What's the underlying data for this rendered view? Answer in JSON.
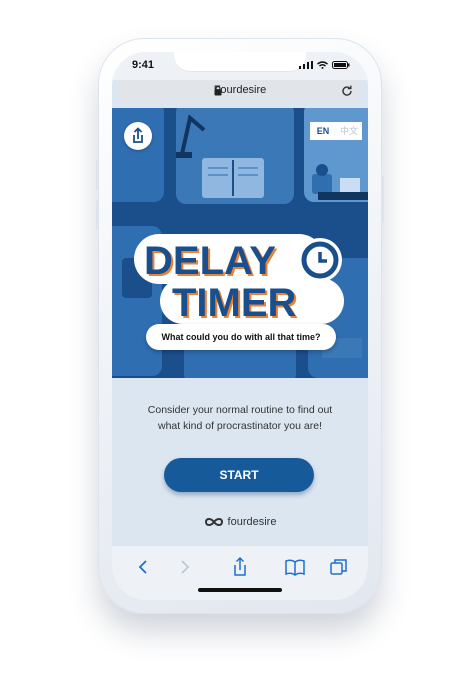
{
  "status_bar": {
    "time": "9:41"
  },
  "browser": {
    "url": "Fourdesire"
  },
  "hero": {
    "lang_en": "EN",
    "lang_zh": "中文",
    "title_line1": "DELAY",
    "title_line2": "TIMER",
    "tagline": "What could you do with all that time?"
  },
  "intro": {
    "line1": "Consider your normal routine to find out",
    "line2": "what kind of procrastinator you are!"
  },
  "start_label": "START",
  "brand": "fourdesire",
  "colors": {
    "primary": "#165a9a",
    "hero_bg": "#1a4f8c",
    "accent_orange": "#e8833a"
  }
}
